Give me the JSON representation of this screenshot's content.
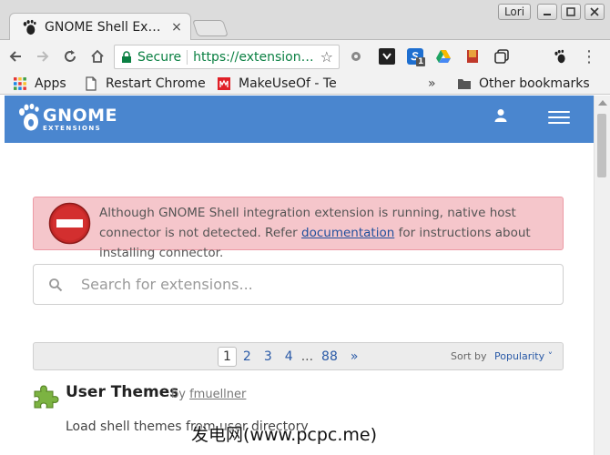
{
  "window": {
    "profile": "Lori",
    "tab_title": "GNOME Shell Extensions",
    "tab_close": "×"
  },
  "toolbar": {
    "secure_label": "Secure",
    "url": "https://extensions.gnome.org",
    "star": "☆",
    "menu": "⋮"
  },
  "bookmarks": {
    "items": [
      "Apps",
      "Restart Chrome",
      "MakeUseOf - Te"
    ],
    "overflow": "»",
    "other": "Other bookmarks"
  },
  "site": {
    "logo_name": "GNOME",
    "logo_sub": "EXTENSIONS"
  },
  "alert": {
    "text_before": "Although GNOME Shell integration extension is running, native host connector is not detected. Refer ",
    "link": "documentation",
    "text_after": " for instructions about installing connector."
  },
  "search": {
    "placeholder": "Search for extensions..."
  },
  "pagination": {
    "pages": [
      "1",
      "2",
      "3",
      "4"
    ],
    "ellipsis": "...",
    "last": "88",
    "next": "»",
    "sort_label": "Sort by",
    "sort_value": "Popularity ˅"
  },
  "results": [
    {
      "title": "User Themes",
      "by": "by",
      "author": "fmuellner",
      "description": "Load shell themes from user directory"
    }
  ],
  "watermark": "(www.pcpc.me)",
  "watermark_prefix": "发电网",
  "colors": {
    "header_blue": "#4a86cf",
    "alert_bg": "#f5c6cb",
    "link_blue": "#2a5aa7",
    "secure_green": "#0b8043"
  }
}
